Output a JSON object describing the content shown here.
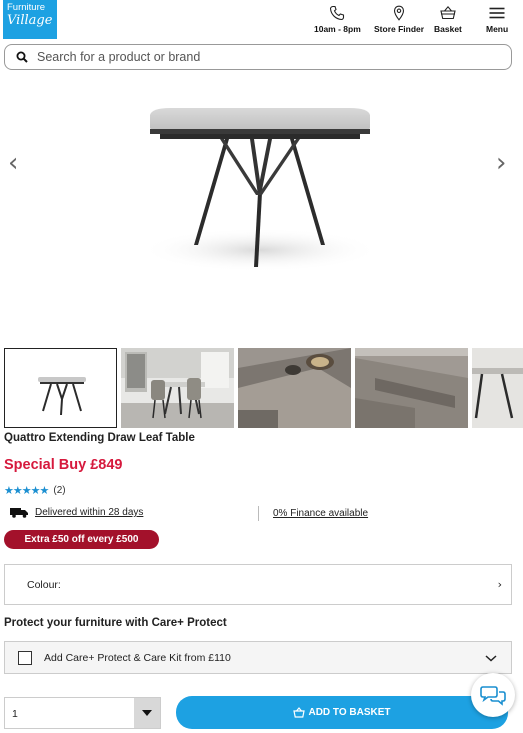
{
  "header": {
    "logo": {
      "line1": "Furniture",
      "line2": "Village"
    },
    "nav": [
      {
        "label": "10am - 8pm",
        "icon": "phone-icon"
      },
      {
        "label": "Store Finder",
        "icon": "location-pin-icon"
      },
      {
        "label": "Basket",
        "icon": "basket-icon"
      },
      {
        "label": "Menu",
        "icon": "hamburger-icon"
      }
    ]
  },
  "search": {
    "placeholder": "Search for a product or brand",
    "icon": "search-icon"
  },
  "gallery": {
    "prev_icon": "chevron-left-icon",
    "next_icon": "chevron-right-icon",
    "thumbnail_count_visible": 5,
    "active_index": 0
  },
  "product": {
    "title": "Quattro Extending Draw Leaf Table",
    "price_label": "Special Buy",
    "price": "£849",
    "rating_stars": 5,
    "review_count": "(2)",
    "delivery": "Delivered within 28 days",
    "finance": "0% Finance available",
    "promo": "Extra £50 off every £500"
  },
  "options": {
    "colour_label": "Colour:",
    "protect_title": "Protect your furniture with Care+ Protect",
    "care_label": "Add Care+ Protect & Care Kit from £110"
  },
  "purchase": {
    "quantity": "1",
    "add_label": "ADD TO BASKET"
  },
  "colors": {
    "brand_blue": "#1da1e2",
    "price_red": "#d6193d",
    "promo_red": "#a3112b",
    "star_blue": "#1b8fd1"
  }
}
